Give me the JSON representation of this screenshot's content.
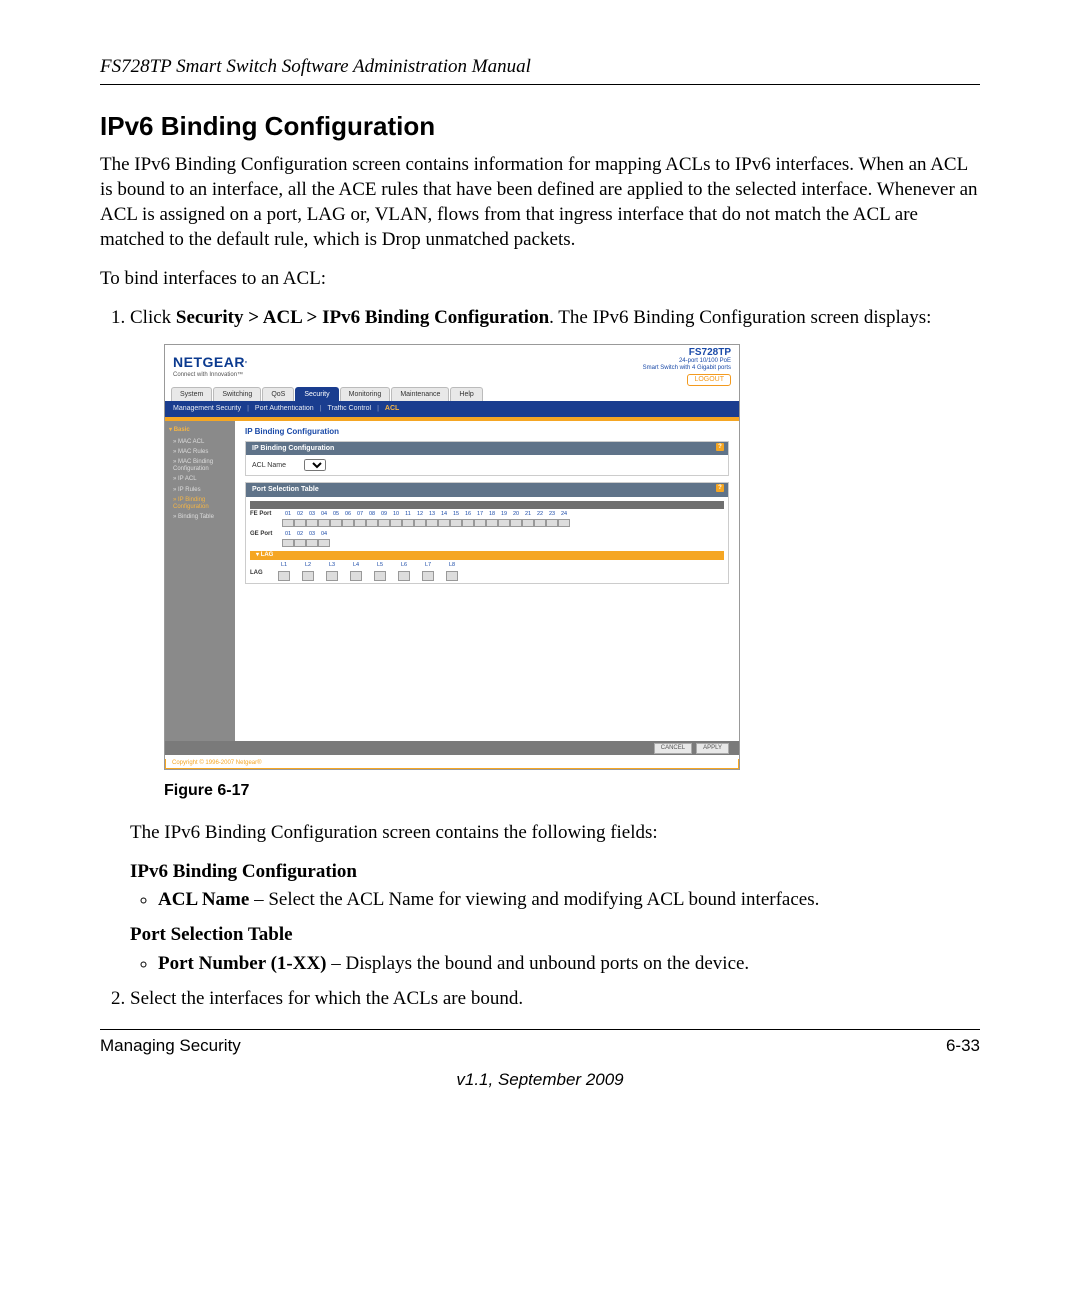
{
  "runhead": "FS728TP Smart Switch Software Administration Manual",
  "title": "IPv6 Binding Configuration",
  "para1": "The IPv6 Binding Configuration screen contains information for mapping ACLs to IPv6 interfaces. When an ACL is bound to an interface, all the ACE rules that have been defined are applied to the selected interface. Whenever an ACL is assigned on a port, LAG or, VLAN, flows from that ingress interface that do not match the ACL are matched to the default rule, which is Drop unmatched packets.",
  "para2": "To bind interfaces to an ACL:",
  "step1_prefix": "Click ",
  "step1_bold": "Security > ACL > IPv6 Binding Configuration",
  "step1_suffix": ". The IPv6 Binding Configuration screen displays:",
  "fig_caption": "Figure 6-17",
  "para3": "The IPv6 Binding Configuration screen contains the following fields:",
  "subhead1": "IPv6 Binding Configuration",
  "field1_bold": "ACL Name",
  "field1_rest": " – Select the ACL Name for viewing and modifying ACL bound interfaces.",
  "subhead2": "Port Selection Table",
  "field2_bold": "Port Number (1-XX)",
  "field2_rest": " – Displays the bound and unbound ports on the device.",
  "step2": "Select the interfaces for which the ACLs are bound.",
  "footer_left": "Managing Security",
  "footer_right": "6-33",
  "footer_ver": "v1.1, September 2009",
  "ss": {
    "brand": "NETGEAR",
    "brand_tag": "Connect with Innovation™",
    "model": "FS728TP",
    "model_sub1": "24-port 10/100 PoE",
    "model_sub2": "Smart Switch with 4 Gigabit ports",
    "logout": "LOGOUT",
    "tabs": [
      "System",
      "Switching",
      "QoS",
      "Security",
      "Monitoring",
      "Maintenance",
      "Help"
    ],
    "tab_active": "Security",
    "subtabs": [
      "Management Security",
      "Port Authentication",
      "Traffic Control",
      "ACL"
    ],
    "subtab_active": "ACL",
    "sidebar_group": "Basic",
    "sidebar_items": [
      "MAC ACL",
      "MAC Rules",
      "MAC Binding Configuration",
      "IP ACL",
      "IP Rules",
      "IP Binding Configuration",
      "Binding Table"
    ],
    "sidebar_selected": "IP Binding Configuration",
    "panel_title": "IP Binding Configuration",
    "panel1_head": "IP Binding Configuration",
    "acl_name_label": "ACL Name",
    "panel2_head": "Port Selection Table",
    "fe_label": "FE Port",
    "fe_ports": [
      "01",
      "02",
      "03",
      "04",
      "05",
      "06",
      "07",
      "08",
      "09",
      "10",
      "11",
      "12",
      "13",
      "14",
      "15",
      "16",
      "17",
      "18",
      "19",
      "20",
      "21",
      "22",
      "23",
      "24"
    ],
    "ge_label": "GE Port",
    "ge_ports": [
      "01",
      "02",
      "03",
      "04"
    ],
    "lag_bar": "LAG",
    "lag_label": "LAG",
    "lags": [
      "L1",
      "L2",
      "L3",
      "L4",
      "L5",
      "L6",
      "L7",
      "L8"
    ],
    "btn_cancel": "CANCEL",
    "btn_apply": "APPLY",
    "copyright": "Copyright © 1996-2007 Netgear®"
  }
}
